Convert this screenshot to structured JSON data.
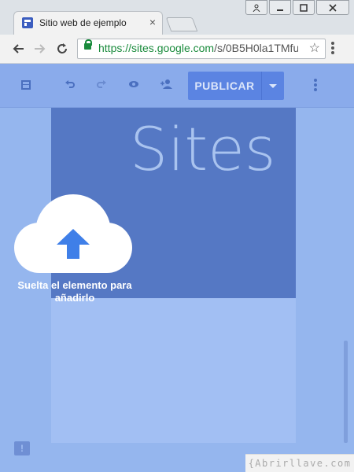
{
  "browser": {
    "tab_title": "Sitio web de ejemplo",
    "tab_close": "×",
    "url_host": "https://sites.google.com",
    "url_path": "/s/0B5H0la1TMfu",
    "window_controls": {
      "user": "user-icon",
      "minimize": "minimize-icon",
      "maximize": "maximize-icon",
      "close": "close-icon"
    }
  },
  "sites_toolbar": {
    "publish_label": "PUBLICAR",
    "icons": [
      "layout-icon",
      "undo-icon",
      "redo-icon",
      "preview-icon",
      "add-person-icon",
      "more-vert-icon"
    ]
  },
  "page": {
    "banner_title": "Sites"
  },
  "overlay": {
    "drop_text": "Suelta el elemento para añadirlo"
  },
  "watermark": "{Abrirllave.com",
  "colors": {
    "accent": "#5b84e2",
    "banner": "#5578c4",
    "background": "#95b6ee"
  }
}
